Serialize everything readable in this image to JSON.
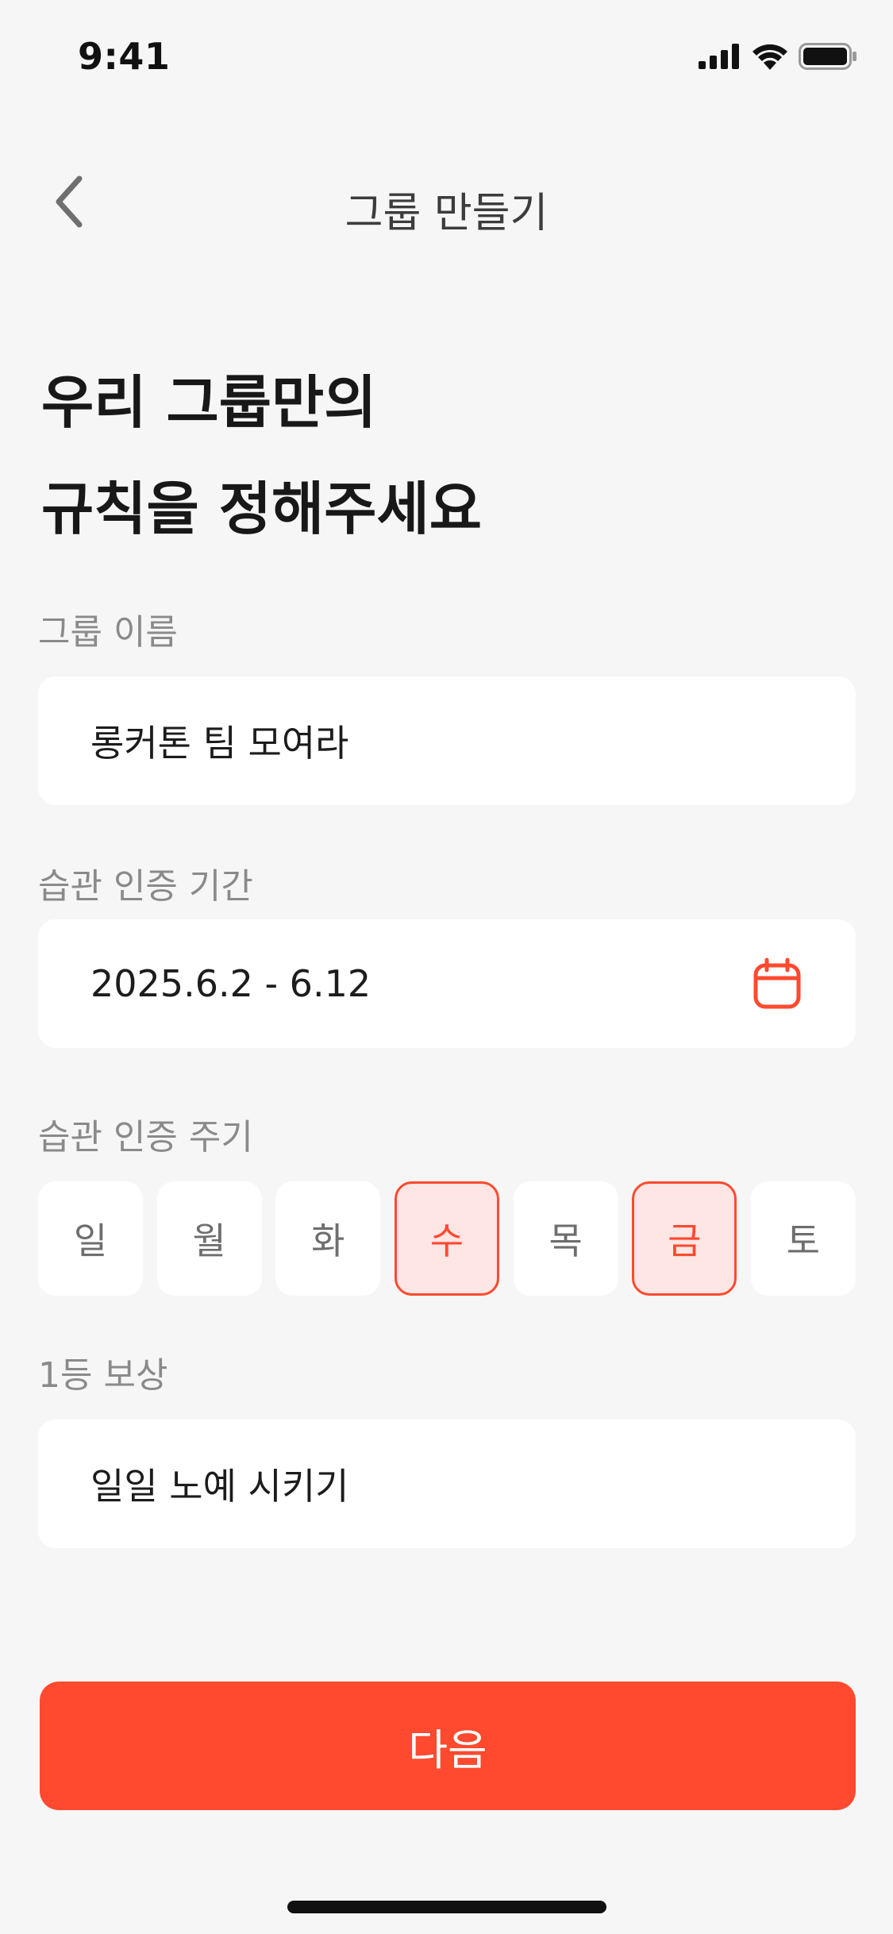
{
  "status_bar": {
    "time": "9:41",
    "icons": [
      "cellular-signal-icon",
      "wifi-icon",
      "battery-icon"
    ]
  },
  "header": {
    "back_icon": "chevron-left-icon",
    "title": "그룹 만들기"
  },
  "headline": {
    "line1": "우리 그룹만의",
    "line2": "규칙을 정해주세요"
  },
  "group_name": {
    "label": "그룹 이름",
    "value": "롱커톤 팀 모여라"
  },
  "period": {
    "label": "습관 인증 기간",
    "value": "2025.6.2 - 6.12",
    "icon": "calendar-icon"
  },
  "cycle": {
    "label": "습관 인증 주기",
    "days": [
      {
        "label": "일",
        "selected": false
      },
      {
        "label": "월",
        "selected": false
      },
      {
        "label": "화",
        "selected": false
      },
      {
        "label": "수",
        "selected": true
      },
      {
        "label": "목",
        "selected": false
      },
      {
        "label": "금",
        "selected": true
      },
      {
        "label": "토",
        "selected": false
      }
    ]
  },
  "reward": {
    "label": "1등 보상",
    "value": "일일 노예 시키기"
  },
  "next_button": {
    "label": "다음"
  },
  "colors": {
    "accent": "#ff4a2f",
    "accent_light": "#fde6e4",
    "background": "#f6f6f6"
  }
}
